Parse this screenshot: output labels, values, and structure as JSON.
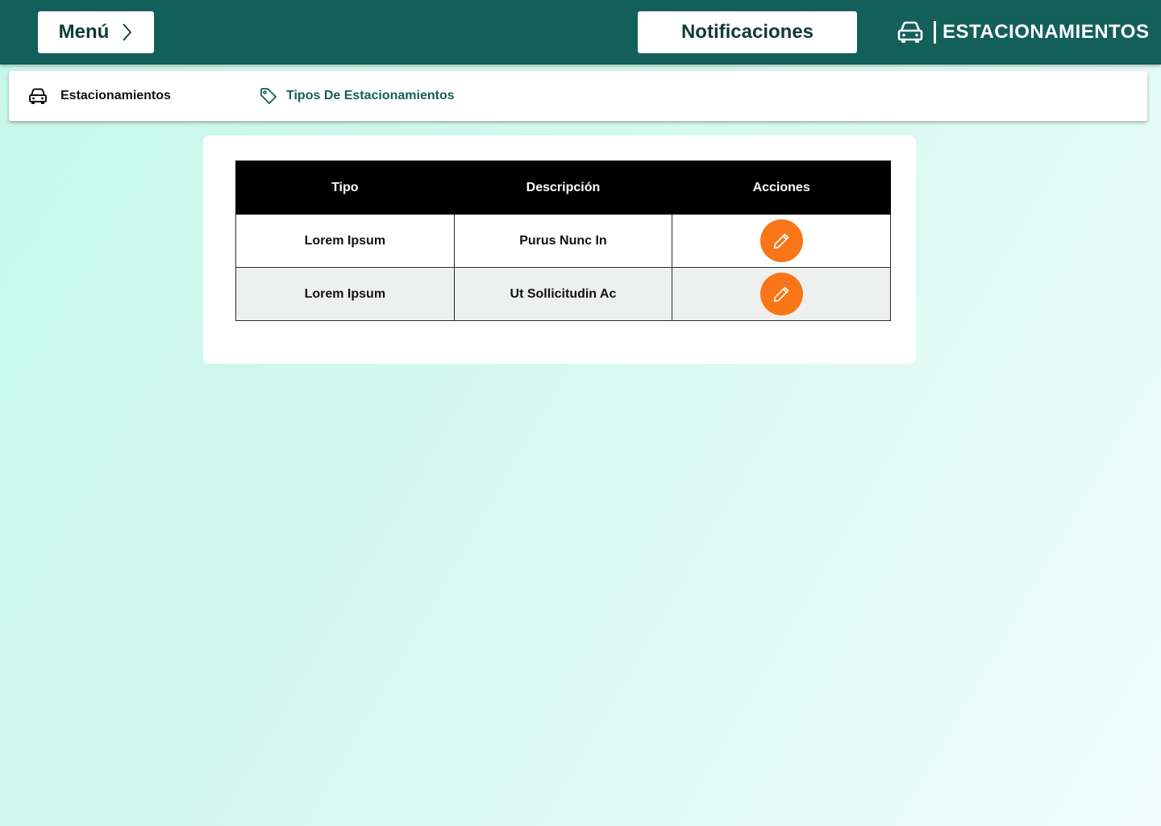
{
  "header": {
    "menu_label": "Menú",
    "notifications_label": "Notificaciones",
    "brand_title": "ESTACIONAMIENTOS",
    "brand_icon": "car-icon",
    "background_color": "#135f5a"
  },
  "tabs": [
    {
      "label": "Estacionamientos",
      "icon": "car-icon"
    },
    {
      "label": "Tipos De Estacionamientos",
      "icon": "tag-icon",
      "active_color": "#135f5a"
    }
  ],
  "table": {
    "headers": [
      "Tipo",
      "Descripción",
      "Acciones"
    ],
    "rows": [
      {
        "tipo": "Lorem Ipsum",
        "descripcion": "Purus Nunc In",
        "action_icon": "pencil-icon"
      },
      {
        "tipo": "Lorem Ipsum",
        "descripcion": "Ut Sollicitudin Ac",
        "action_icon": "pencil-icon"
      }
    ],
    "action_color": "#f97618"
  }
}
